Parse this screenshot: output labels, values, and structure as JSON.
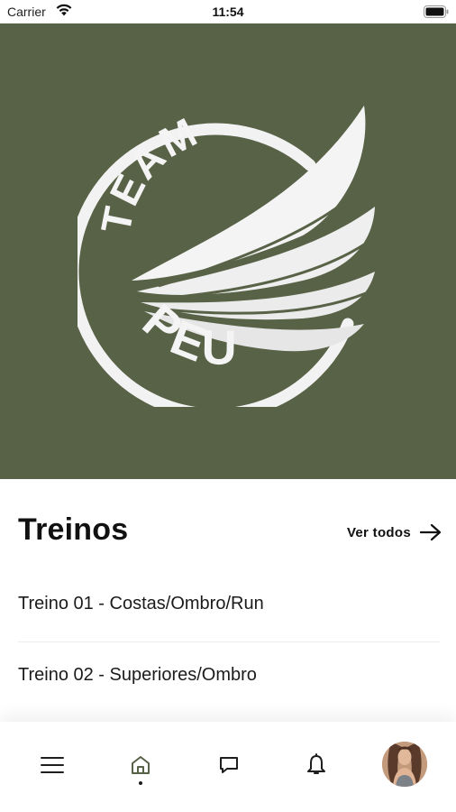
{
  "status_bar": {
    "carrier": "Carrier",
    "time": "11:54"
  },
  "hero": {
    "brand_top": "TEAM",
    "brand_bottom": "PEU",
    "background_color": "#586247"
  },
  "workouts": {
    "title": "Treinos",
    "see_all_label": "Ver todos",
    "items": [
      {
        "label": "Treino 01 - Costas/Ombro/Run"
      },
      {
        "label": "Treino 02 - Superiores/Ombro"
      }
    ]
  },
  "tab_bar": {
    "active_tab": "home",
    "tabs": [
      {
        "icon": "menu-icon"
      },
      {
        "icon": "home-icon"
      },
      {
        "icon": "chat-icon"
      },
      {
        "icon": "bell-icon"
      },
      {
        "icon": "avatar"
      }
    ]
  }
}
